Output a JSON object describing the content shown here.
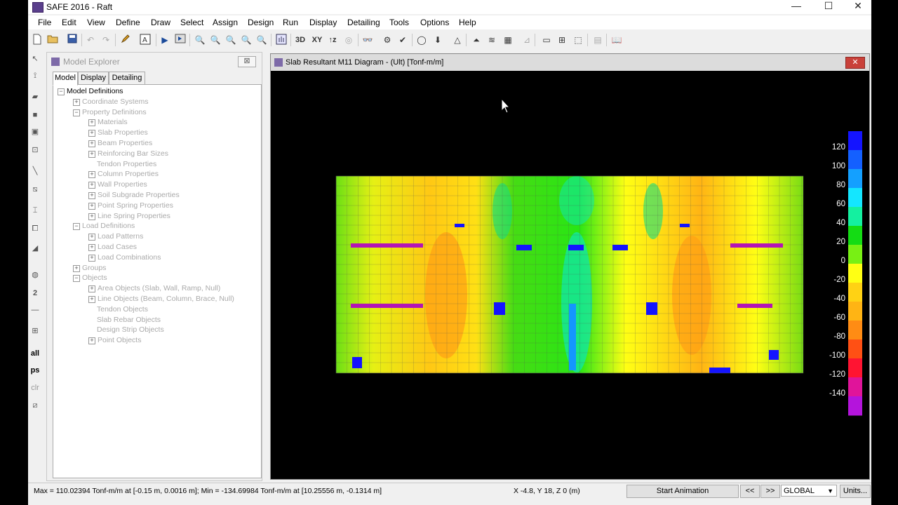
{
  "app": {
    "title": "SAFE 2016 - Raft"
  },
  "window_controls": {
    "minimize": "—",
    "maximize": "☐",
    "close": "✕"
  },
  "menu": [
    "File",
    "Edit",
    "View",
    "Define",
    "Draw",
    "Select",
    "Assign",
    "Design",
    "Run",
    "Display",
    "Detailing",
    "Tools",
    "Options",
    "Help"
  ],
  "toolbar_icons": [
    "new-file",
    "open-folder",
    "save",
    "undo",
    "redo",
    "pencil",
    "refresh-window",
    "run",
    "run-analysis",
    "zoom-rectangle",
    "zoom-in",
    "zoom-out",
    "zoom-restore",
    "zoom-previous",
    "pan",
    "3d-view",
    "xy-plane",
    "z-view",
    "rotate-view",
    "set-display",
    "set-building-view",
    "check",
    "circle",
    "arrow-down",
    "triangle",
    "triangle-outline",
    "spring",
    "piers",
    "calculator",
    "area-loads",
    "line-loads",
    "table",
    "show-tables",
    "table-grid",
    "book"
  ],
  "toolbar_text": {
    "view3d": "3D",
    "viewxy": "XY",
    "viewz": "↑z"
  },
  "side_tools": {
    "all": "all",
    "ps": "ps",
    "clr": "clr",
    "two": "2"
  },
  "explorer": {
    "title": "Model Explorer",
    "close": "⊠",
    "tabs": [
      "Model",
      "Display",
      "Detailing"
    ],
    "tree": [
      {
        "label": "Model Definitions",
        "level": 0,
        "expander": "−",
        "root": true
      },
      {
        "label": "Coordinate Systems",
        "level": 1,
        "expander": "+"
      },
      {
        "label": "Property Definitions",
        "level": 1,
        "expander": "−"
      },
      {
        "label": "Materials",
        "level": 2,
        "expander": "+"
      },
      {
        "label": "Slab Properties",
        "level": 2,
        "expander": "+"
      },
      {
        "label": "Beam Properties",
        "level": 2,
        "expander": "+"
      },
      {
        "label": "Reinforcing Bar Sizes",
        "level": 2,
        "expander": "+"
      },
      {
        "label": "Tendon Properties",
        "level": 2,
        "expander": ""
      },
      {
        "label": "Column Properties",
        "level": 2,
        "expander": "+"
      },
      {
        "label": "Wall Properties",
        "level": 2,
        "expander": "+"
      },
      {
        "label": "Soil Subgrade Properties",
        "level": 2,
        "expander": "+"
      },
      {
        "label": "Point Spring Properties",
        "level": 2,
        "expander": "+"
      },
      {
        "label": "Line Spring Properties",
        "level": 2,
        "expander": "+"
      },
      {
        "label": "Load Definitions",
        "level": 1,
        "expander": "−"
      },
      {
        "label": "Load Patterns",
        "level": 2,
        "expander": "+"
      },
      {
        "label": "Load Cases",
        "level": 2,
        "expander": "+"
      },
      {
        "label": "Load Combinations",
        "level": 2,
        "expander": "+"
      },
      {
        "label": "Groups",
        "level": 1,
        "expander": "+"
      },
      {
        "label": "Objects",
        "level": 1,
        "expander": "−"
      },
      {
        "label": "Area Objects (Slab, Wall, Ramp, Null)",
        "level": 2,
        "expander": "+"
      },
      {
        "label": "Line Objects (Beam, Column, Brace, Null)",
        "level": 2,
        "expander": "+"
      },
      {
        "label": "Tendon Objects",
        "level": 2,
        "expander": ""
      },
      {
        "label": "Slab Rebar Objects",
        "level": 2,
        "expander": ""
      },
      {
        "label": "Design Strip Objects",
        "level": 2,
        "expander": ""
      },
      {
        "label": "Point Objects",
        "level": 2,
        "expander": "+"
      }
    ]
  },
  "plot": {
    "title": "Slab Resultant M11 Diagram - (Ult)  [Tonf-m/m]",
    "close": "✕",
    "legend": [
      {
        "value": "120",
        "color": "#1414ff"
      },
      {
        "value": "100",
        "color": "#1460ff"
      },
      {
        "value": "80",
        "color": "#14a0ff"
      },
      {
        "value": "60",
        "color": "#14e6ff"
      },
      {
        "value": "40",
        "color": "#14f0a0"
      },
      {
        "value": "20",
        "color": "#14dc14"
      },
      {
        "value": "0",
        "color": "#78f014"
      },
      {
        "value": "-20",
        "color": "#ffff14"
      },
      {
        "value": "-40",
        "color": "#ffd214"
      },
      {
        "value": "-60",
        "color": "#ffb414"
      },
      {
        "value": "-80",
        "color": "#ff8c14"
      },
      {
        "value": "-100",
        "color": "#ff5014"
      },
      {
        "value": "-120",
        "color": "#ff1432"
      },
      {
        "value": "-140",
        "color": "#e0149a"
      },
      {
        "value": "",
        "color": "#b414dc"
      }
    ]
  },
  "status": {
    "maxmin": "Max = 110.02394 Tonf-m/m at [-0.15 m, 0.0016 m];  Min = -134.69984 Tonf-m/m at [10.25556 m, -0.1314 m]",
    "coords": "X -4.8,  Y 18,  Z 0  (m)",
    "animation": "Start Animation",
    "prev": "<<",
    "next": ">>",
    "coord_system": "GLOBAL",
    "units": "Units..."
  }
}
